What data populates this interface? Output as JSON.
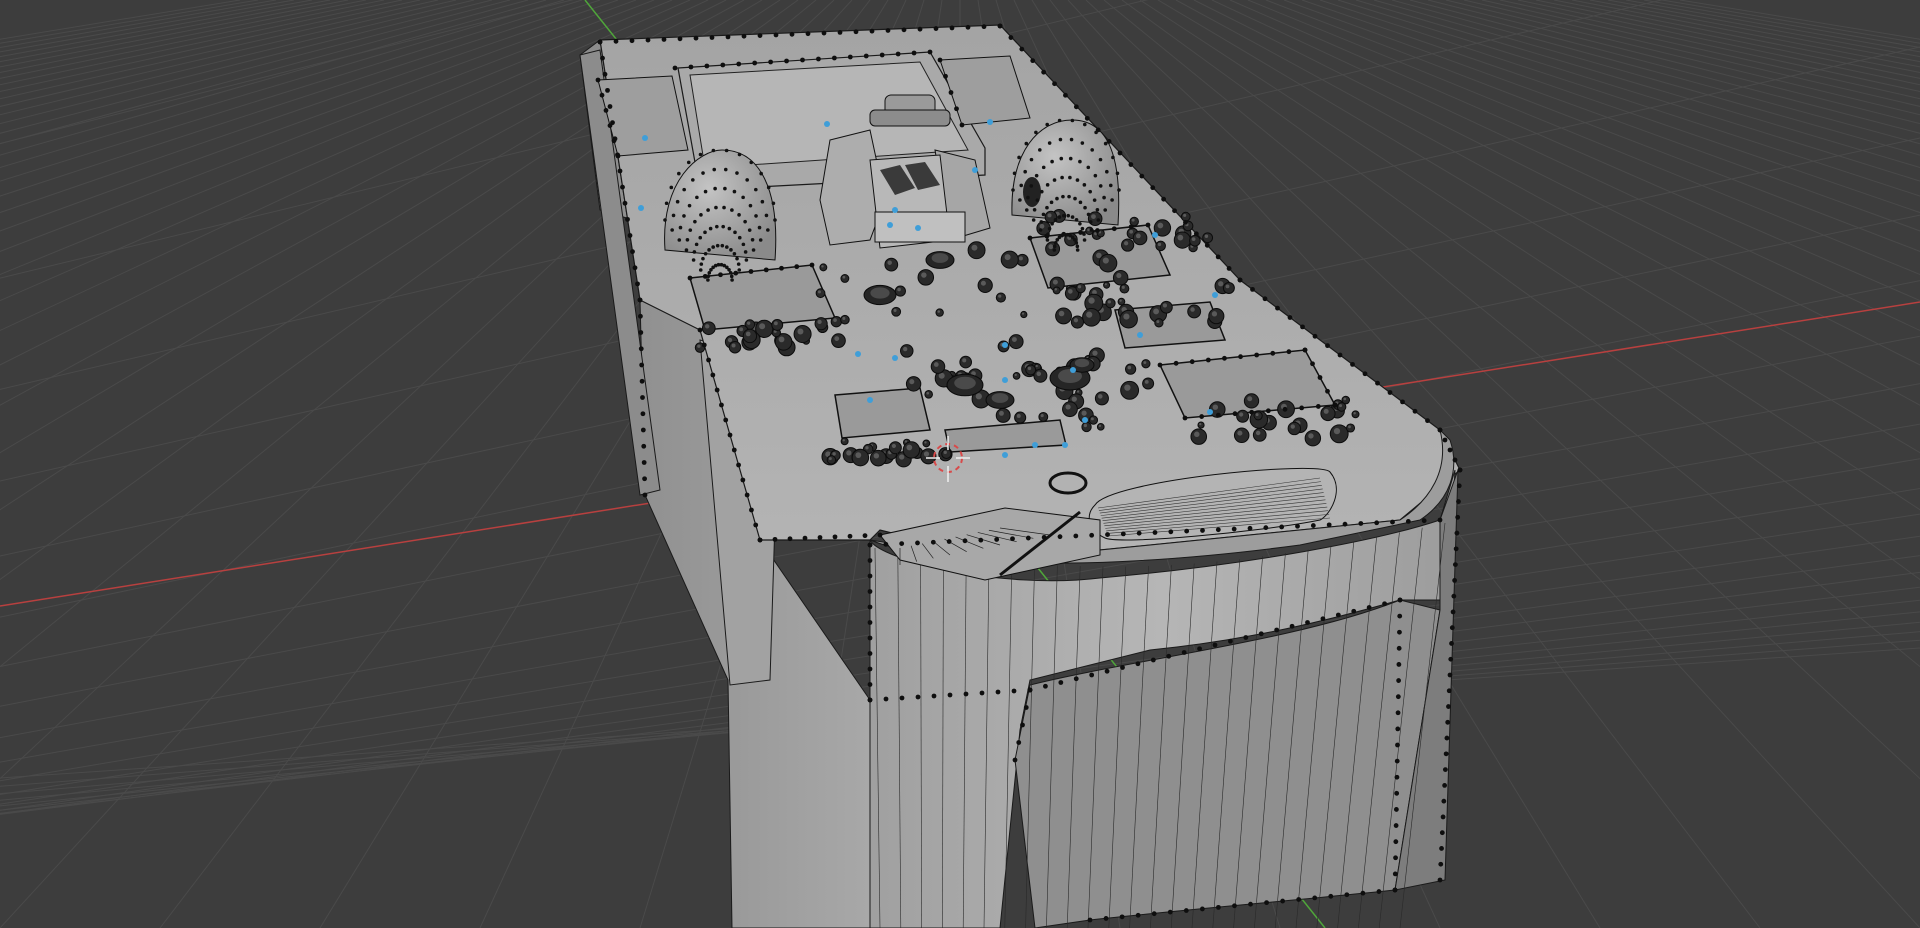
{
  "viewport": {
    "mode": "edit-mode",
    "shading": "solid",
    "colors": {
      "background": "#3d3d3d",
      "grid_line": "#4a4a4a",
      "x_axis": "#b8403f",
      "y_axis": "#4fa63a",
      "mesh_light": "#b0b0b0",
      "mesh_mid": "#9a9a9a",
      "mesh_dark": "#7c7c7c",
      "wire": "#1a1a1a",
      "selected_vertex": "#3f9ed8",
      "cursor_red": "#d84a4a",
      "cursor_white": "#f0f0f0"
    },
    "objects": [
      {
        "name": "cockpit-console-mesh",
        "type": "mesh"
      },
      {
        "name": "3d-cursor",
        "type": "cursor"
      }
    ]
  }
}
